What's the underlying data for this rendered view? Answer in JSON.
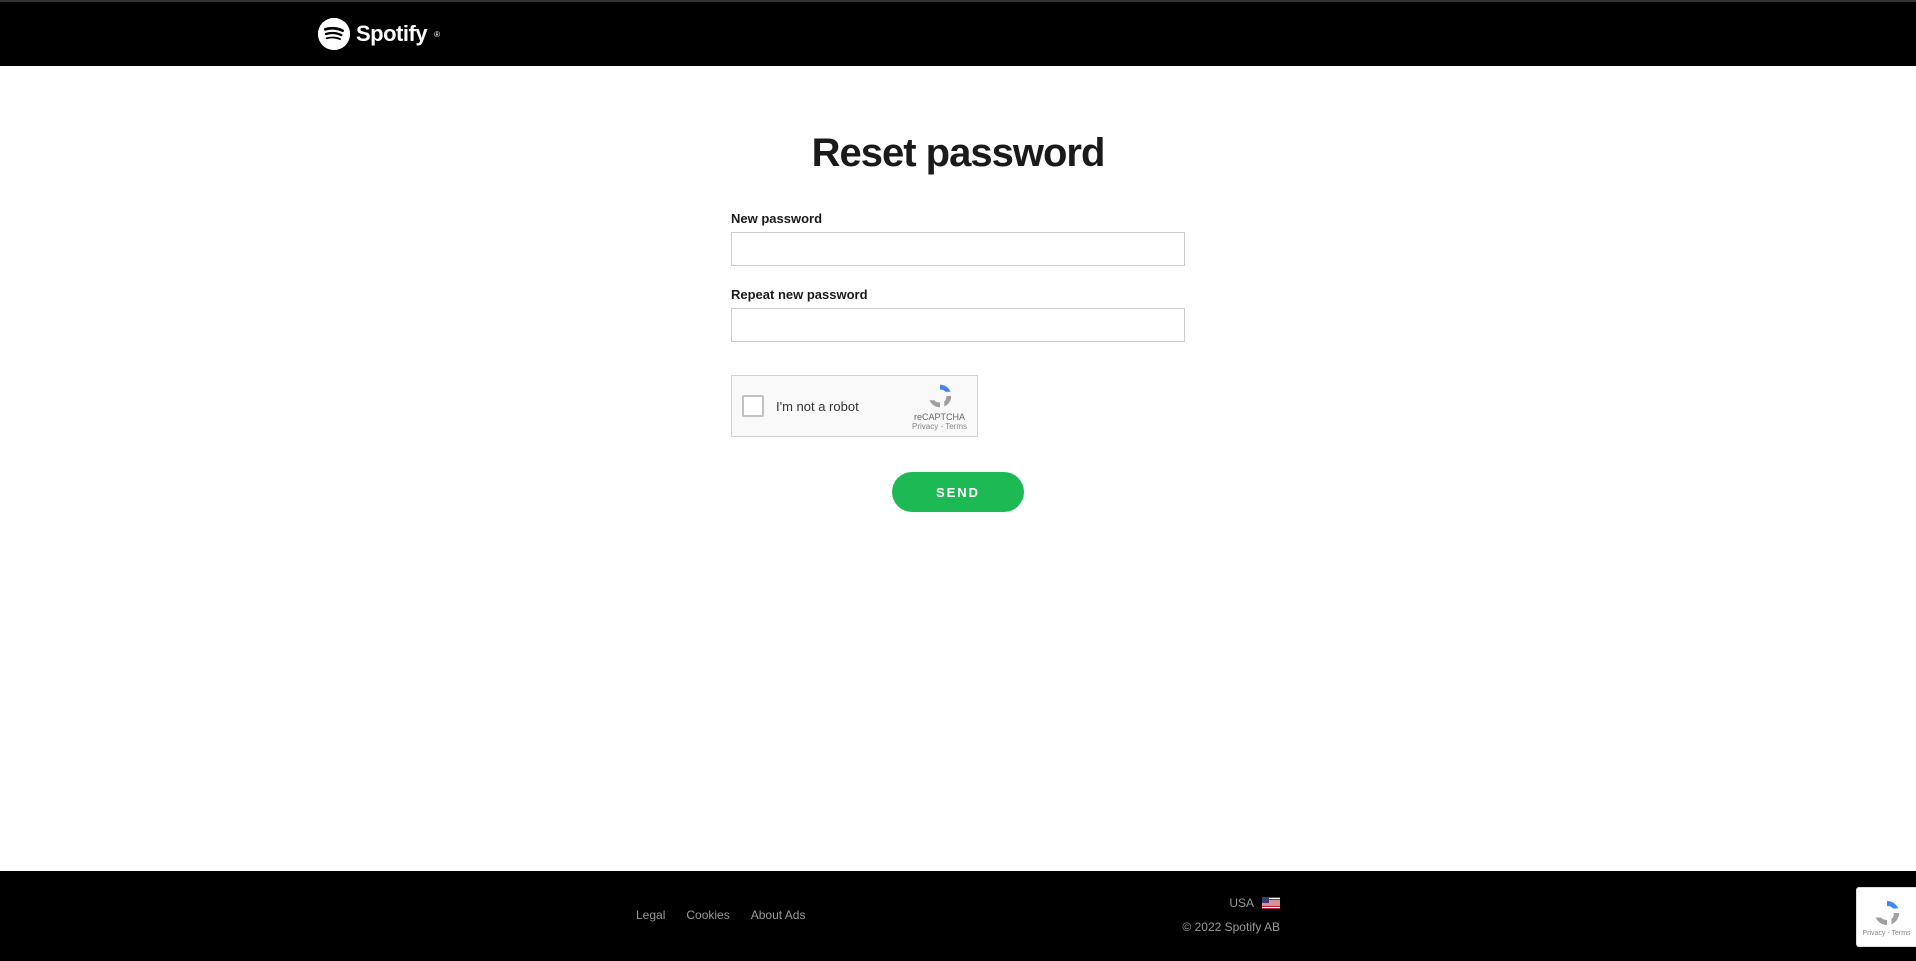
{
  "header": {
    "brand": "Spotify"
  },
  "main": {
    "title": "Reset password",
    "new_password_label": "New password",
    "repeat_password_label": "Repeat new password",
    "send_button": "SEND"
  },
  "recaptcha": {
    "label": "I'm not a robot",
    "brand": "reCAPTCHA",
    "privacy": "Privacy",
    "terms": "Terms"
  },
  "footer": {
    "links": {
      "legal": "Legal",
      "cookies": "Cookies",
      "about_ads": "About Ads"
    },
    "country": "USA",
    "copyright": "© 2022 Spotify AB"
  },
  "badge": {
    "text": "Privacy - Terms"
  }
}
